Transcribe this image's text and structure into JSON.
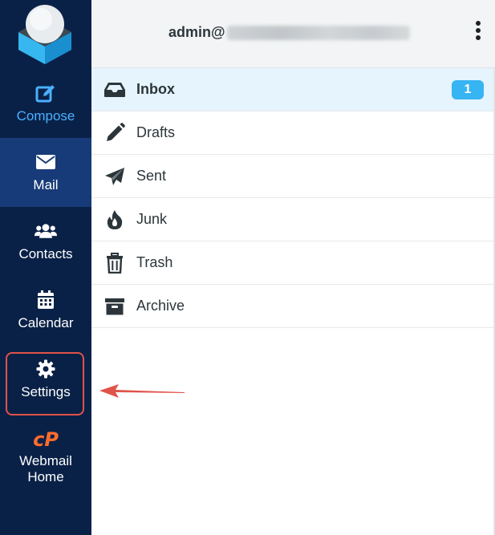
{
  "sidebar": {
    "items": [
      {
        "label": "Compose",
        "icon": "compose-icon"
      },
      {
        "label": "Mail",
        "icon": "envelope-icon"
      },
      {
        "label": "Contacts",
        "icon": "users-icon"
      },
      {
        "label": "Calendar",
        "icon": "calendar-icon"
      },
      {
        "label": "Settings",
        "icon": "gear-icon"
      },
      {
        "label": "Webmail Home",
        "icon": "cpanel-icon"
      }
    ],
    "cpanel_logo_text": "cP"
  },
  "header": {
    "account_prefix": "admin@"
  },
  "folders": [
    {
      "name": "Inbox",
      "icon": "inbox-icon",
      "unread": "1"
    },
    {
      "name": "Drafts",
      "icon": "pencil-icon"
    },
    {
      "name": "Sent",
      "icon": "paper-plane-icon"
    },
    {
      "name": "Junk",
      "icon": "fire-icon"
    },
    {
      "name": "Trash",
      "icon": "trash-icon"
    },
    {
      "name": "Archive",
      "icon": "archive-icon"
    }
  ],
  "colors": {
    "sidebar_bg": "#0a2147",
    "sidebar_active_bg": "#173a78",
    "compose_accent": "#4ab0ff",
    "cpanel_orange": "#ff6c2c",
    "badge": "#37b4f2",
    "highlight": "#e0534a"
  }
}
